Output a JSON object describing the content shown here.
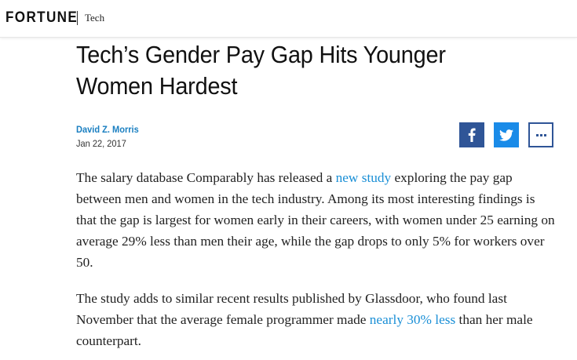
{
  "header": {
    "logo": "FORTUNE",
    "section": "Tech"
  },
  "article": {
    "headline": "Tech’s Gender Pay Gap Hits Younger Women Hardest",
    "author": "David Z. Morris",
    "date": "Jan 22, 2017",
    "share": {
      "facebook_icon": "facebook-icon",
      "twitter_icon": "twitter-icon",
      "more_icon": "more-options-icon"
    },
    "paragraph1": {
      "before": "The salary database Comparably has released a ",
      "link": "new study",
      "after": " exploring the pay gap between men and women in the tech industry. Among its most interesting findings is that the gap is largest for women early in their careers, with women under 25 earning on average 29% less than men their age, while the gap drops to only 5% for workers over 50."
    },
    "paragraph2": {
      "before": "The study adds to similar recent results published by Glassdoor, who found last November that the average female programmer made ",
      "link": "nearly 30% less",
      "after": " than her male counterpart."
    }
  },
  "colors": {
    "link": "#1a8fd6",
    "author": "#1a7fc1",
    "facebook": "#2f5597",
    "twitter": "#1a8be8"
  }
}
